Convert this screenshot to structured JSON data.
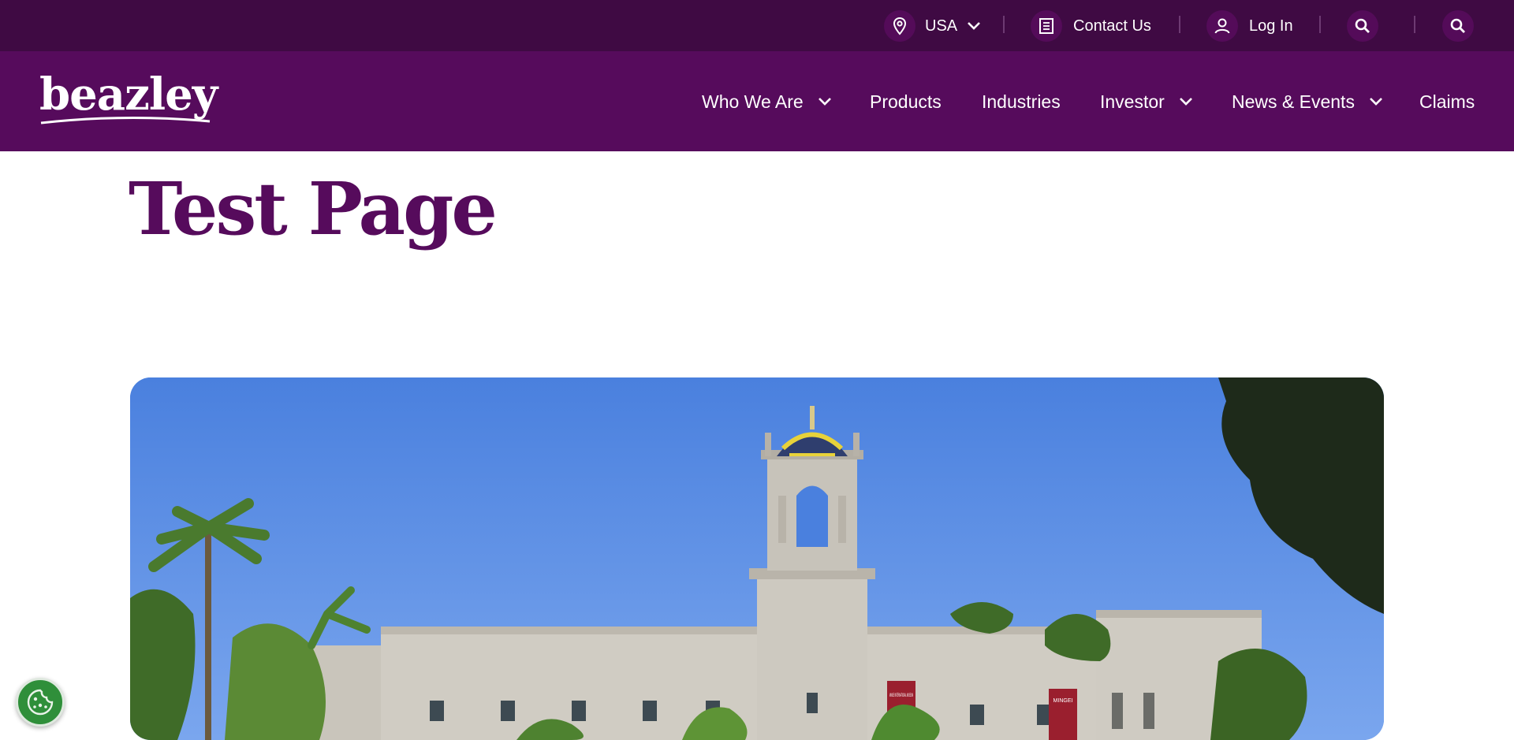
{
  "utility_bar": {
    "region_label": "USA",
    "contact_label": "Contact Us",
    "login_label": "Log In",
    "icons": [
      "location-pin-icon",
      "chevron-down-icon",
      "document-icon",
      "user-icon",
      "search-icon",
      "search-icon"
    ]
  },
  "header": {
    "logo_text": "beazley",
    "nav": {
      "who_we_are": "Who We Are",
      "products": "Products",
      "industries": "Industries",
      "investor": "Investor",
      "news_events": "News & Events",
      "claims": "Claims"
    }
  },
  "page": {
    "title": "Test Page"
  },
  "hero": {
    "banner_1": "MINGEI INTERNATIONAL MUSEUM",
    "banner_2": "MINGEI"
  },
  "cookie_button": {
    "icon": "cookie-icon"
  },
  "colors": {
    "utility_bg": "#3f0a43",
    "nav_bg": "#560b5c",
    "brand_purple": "#560b5c",
    "cookie_green": "#2f8f3a"
  }
}
